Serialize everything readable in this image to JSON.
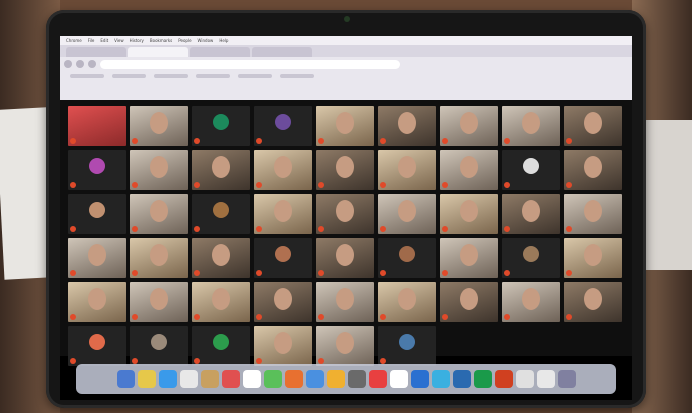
{
  "browser": {
    "menu_items": [
      "Chrome",
      "File",
      "Edit",
      "View",
      "History",
      "Bookmarks",
      "People",
      "Window",
      "Help"
    ],
    "tabs": [
      "",
      "",
      "",
      ""
    ],
    "url": ""
  },
  "tiles": [
    {
      "kind": "red",
      "name": ""
    },
    {
      "kind": "video",
      "tone": "c1",
      "name": ""
    },
    {
      "kind": "avatar",
      "color": "#1c8a5c",
      "name": ""
    },
    {
      "kind": "avatar",
      "color": "#6c4c9c",
      "name": ""
    },
    {
      "kind": "video",
      "tone": "c3",
      "name": ""
    },
    {
      "kind": "video",
      "tone": "c2",
      "name": ""
    },
    {
      "kind": "video",
      "tone": "c1",
      "name": ""
    },
    {
      "kind": "video",
      "tone": "c1",
      "name": ""
    },
    {
      "kind": "video",
      "tone": "c2",
      "name": ""
    },
    {
      "kind": "avatar",
      "color": "#b04ab0",
      "name": ""
    },
    {
      "kind": "video",
      "tone": "c1",
      "name": ""
    },
    {
      "kind": "video",
      "tone": "c2",
      "name": ""
    },
    {
      "kind": "video",
      "tone": "c3",
      "name": ""
    },
    {
      "kind": "video",
      "tone": "c2",
      "name": ""
    },
    {
      "kind": "video",
      "tone": "c3",
      "name": ""
    },
    {
      "kind": "video",
      "tone": "c1",
      "name": ""
    },
    {
      "kind": "avatar",
      "color": "#ddd",
      "name": ""
    },
    {
      "kind": "video",
      "tone": "c2",
      "name": ""
    },
    {
      "kind": "avatar",
      "color": "#c09070",
      "name": ""
    },
    {
      "kind": "video",
      "tone": "c1",
      "name": ""
    },
    {
      "kind": "avatar",
      "color": "#a07040",
      "name": ""
    },
    {
      "kind": "video",
      "tone": "c3",
      "name": ""
    },
    {
      "kind": "video",
      "tone": "c2",
      "name": ""
    },
    {
      "kind": "video",
      "tone": "c1",
      "name": ""
    },
    {
      "kind": "video",
      "tone": "c3",
      "name": ""
    },
    {
      "kind": "video",
      "tone": "c2",
      "name": ""
    },
    {
      "kind": "video",
      "tone": "c1",
      "name": ""
    },
    {
      "kind": "video",
      "tone": "c1",
      "name": ""
    },
    {
      "kind": "video",
      "tone": "c3",
      "name": ""
    },
    {
      "kind": "video",
      "tone": "c2",
      "name": ""
    },
    {
      "kind": "avatar",
      "color": "#b07050",
      "name": ""
    },
    {
      "kind": "video",
      "tone": "c2",
      "name": ""
    },
    {
      "kind": "avatar",
      "color": "#a06a4a",
      "name": ""
    },
    {
      "kind": "video",
      "tone": "c1",
      "name": ""
    },
    {
      "kind": "avatar",
      "color": "#9a7a5a",
      "name": ""
    },
    {
      "kind": "video",
      "tone": "c3",
      "name": ""
    },
    {
      "kind": "video",
      "tone": "c3",
      "name": ""
    },
    {
      "kind": "video",
      "tone": "c1",
      "name": ""
    },
    {
      "kind": "video",
      "tone": "c3",
      "name": ""
    },
    {
      "kind": "video",
      "tone": "c2",
      "name": ""
    },
    {
      "kind": "video",
      "tone": "c1",
      "name": ""
    },
    {
      "kind": "video",
      "tone": "c3",
      "name": ""
    },
    {
      "kind": "video",
      "tone": "c2",
      "name": ""
    },
    {
      "kind": "video",
      "tone": "c1",
      "name": ""
    },
    {
      "kind": "video",
      "tone": "c2",
      "name": ""
    },
    {
      "kind": "avatar",
      "color": "#e06a4a",
      "name": ""
    },
    {
      "kind": "avatar",
      "color": "#9a8a7a",
      "name": ""
    },
    {
      "kind": "avatar",
      "color": "#2c9c4c",
      "name": ""
    },
    {
      "kind": "video",
      "tone": "c3",
      "name": ""
    },
    {
      "kind": "video",
      "tone": "c1",
      "name": ""
    },
    {
      "kind": "avatar",
      "color": "#4a7aaa",
      "name": ""
    }
  ],
  "dock_colors": [
    "#4a7ad0",
    "#e6c84a",
    "#3a9aea",
    "#e8e8e8",
    "#c8a060",
    "#e05050",
    "#ffffff",
    "#5ac05a",
    "#e87030",
    "#4a90e0",
    "#f0b030",
    "#6a6a6a",
    "#e84040",
    "#ffffff",
    "#2a70d0",
    "#3ab0e0",
    "#2a6ab0",
    "#1a9a4a",
    "#d04020",
    "#e0e0e0",
    "#e8e8e8",
    "#8080a0"
  ]
}
